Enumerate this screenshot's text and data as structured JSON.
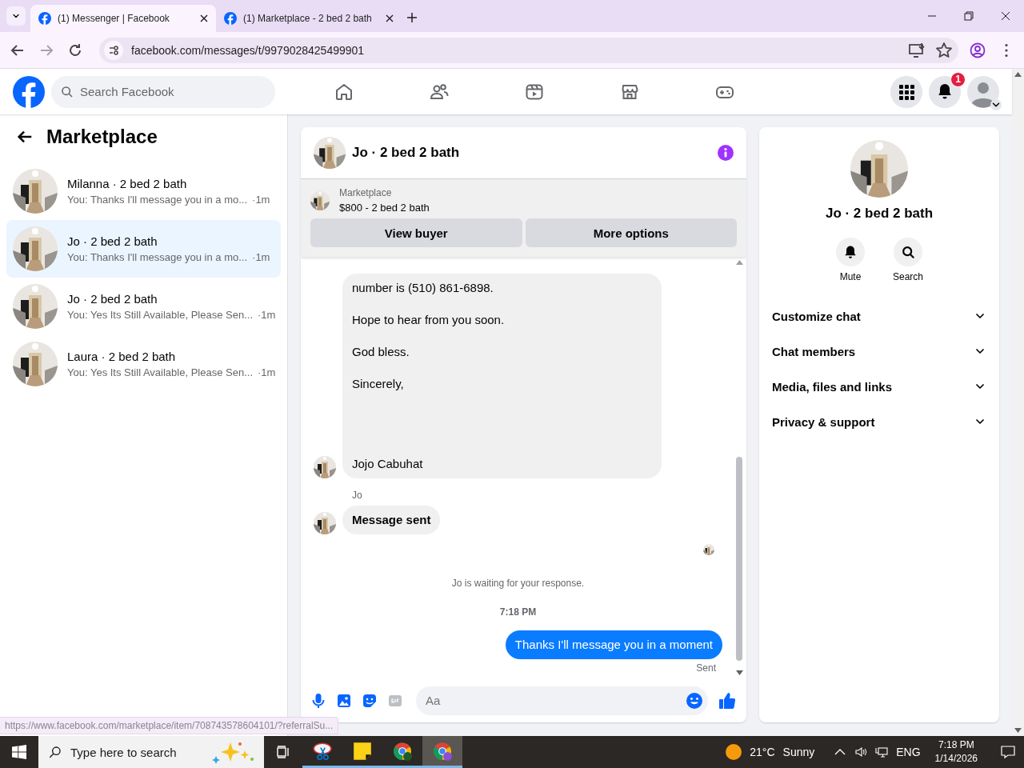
{
  "browser": {
    "tabs": [
      {
        "title": "(1) Messenger | Facebook",
        "selected": true
      },
      {
        "title": "(1) Marketplace - 2 bed 2 bath",
        "selected": false
      }
    ],
    "url": "facebook.com/messages/t/9979028425499901",
    "status_url": "https://www.facebook.com/marketplace/item/708743578604101/?referralSu..."
  },
  "header": {
    "search_placeholder": "Search Facebook",
    "nav": [
      {
        "kind": "home"
      },
      {
        "kind": "friends"
      },
      {
        "kind": "video"
      },
      {
        "kind": "marketplace"
      },
      {
        "kind": "gaming"
      }
    ],
    "notification_count": "1"
  },
  "sidebar": {
    "title": "Marketplace",
    "chats": [
      {
        "name": "Milanna · 2 bed 2 bath",
        "preview": "You: Thanks I'll message you in a mo...",
        "time": "·1m",
        "selected": false
      },
      {
        "name": "Jo · 2 bed 2 bath",
        "preview": "You: Thanks I'll message you in a mo...",
        "time": "·1m",
        "selected": true
      },
      {
        "name": "Jo · 2 bed 2 bath",
        "preview": "You: Yes Its Still Available, Please Sen...",
        "time": "·1m",
        "selected": false
      },
      {
        "name": "Laura · 2 bed 2 bath",
        "preview": "You: Yes Its Still Available, Please Sen...",
        "time": "·1m",
        "selected": false
      }
    ]
  },
  "chat": {
    "title": "Jo · 2 bed 2 bath",
    "listing": {
      "label": "Marketplace",
      "title": "$800 - 2 bed 2 bath"
    },
    "actions": [
      "View buyer",
      "More options"
    ],
    "messages": [
      {
        "kind": "incoming",
        "emphasis": false,
        "paragraphs": [
          "number is (510) 861-6898.",
          "Hope to hear from you soon.",
          "God bless.",
          "Sincerely,",
          "Jojo Cabuhat"
        ]
      },
      {
        "kind": "sender",
        "text": "Jo"
      },
      {
        "kind": "incoming",
        "emphasis": true,
        "paragraphs": [
          "Message sent"
        ]
      },
      {
        "kind": "seen"
      },
      {
        "kind": "notice",
        "text": "Jo is waiting for your response."
      },
      {
        "kind": "time",
        "text": "7:18 PM"
      },
      {
        "kind": "outgoing",
        "paragraphs": [
          "Thanks I'll message you in a moment"
        ]
      },
      {
        "kind": "status",
        "text": "Sent"
      }
    ],
    "composer_placeholder": "Aa"
  },
  "info_panel": {
    "name": "Jo · 2 bed 2 bath",
    "actions": [
      {
        "kind": "mute",
        "label": "Mute"
      },
      {
        "kind": "search",
        "label": "Search"
      }
    ],
    "sections": [
      {
        "title": "Customize chat",
        "expanded": false
      },
      {
        "title": "Chat members",
        "expanded": false
      },
      {
        "title": "Media, files and links",
        "expanded": false
      },
      {
        "title": "Privacy & support",
        "expanded": false
      }
    ]
  },
  "taskbar": {
    "search_placeholder": "Type here to search",
    "apps": [
      {
        "kind": "snip",
        "selected": false
      },
      {
        "kind": "notes",
        "selected": false
      },
      {
        "kind": "chrome-u",
        "selected": false
      },
      {
        "kind": "chrome-profile",
        "selected": true
      }
    ],
    "weather": {
      "temp": "21°C",
      "condition": "Sunny"
    },
    "language": "ENG",
    "time": "7:18 PM",
    "date": "1/14/2026"
  }
}
